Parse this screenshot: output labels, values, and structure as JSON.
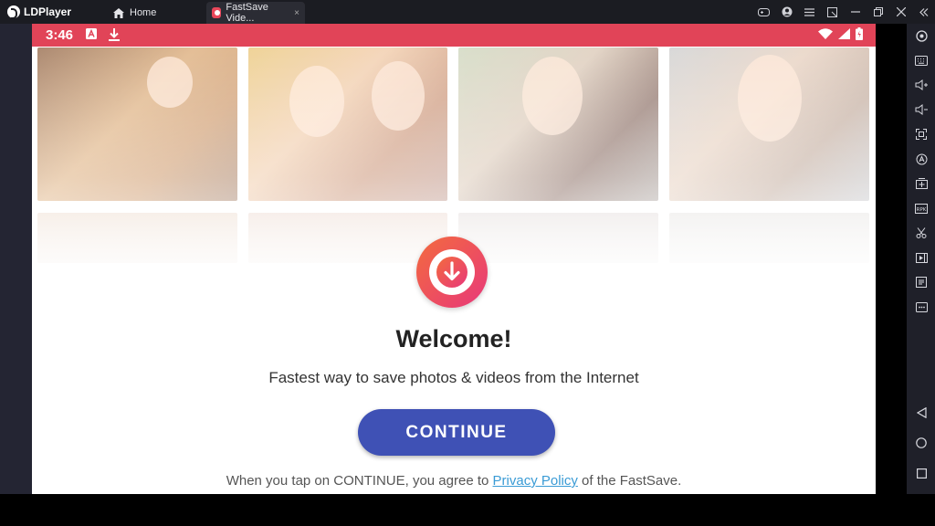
{
  "window": {
    "app_name": "LDPlayer",
    "tabs": [
      {
        "label": "Home",
        "icon": "home-icon"
      },
      {
        "label": "FastSave Vide...",
        "icon": "fastsave-app-icon",
        "close": "×"
      }
    ]
  },
  "android": {
    "status_bar": {
      "time": "3:46",
      "color": "#e14458"
    },
    "welcome": {
      "title": "Welcome!",
      "subtitle": "Fastest way to save photos & videos from the Internet",
      "continue_label": "CONTINUE",
      "legal_prefix": "When you tap on CONTINUE, you agree to ",
      "privacy_link": "Privacy Policy",
      "legal_suffix": " of the FastSave."
    },
    "colors": {
      "button": "#3f51b5",
      "link": "#3a9bd5",
      "badge_gradient": [
        "#f36b3e",
        "#e8387a"
      ]
    }
  },
  "sidebar_icons": [
    "settings-icon",
    "keyboard-icon",
    "volume-up-icon",
    "volume-down-icon",
    "screenshot-icon",
    "sync-icon",
    "install-apk-icon",
    "fps-icon",
    "scissors-icon",
    "video-record-icon",
    "operations-icon",
    "more-icon",
    "back-icon",
    "home-circle-icon",
    "recents-icon"
  ]
}
